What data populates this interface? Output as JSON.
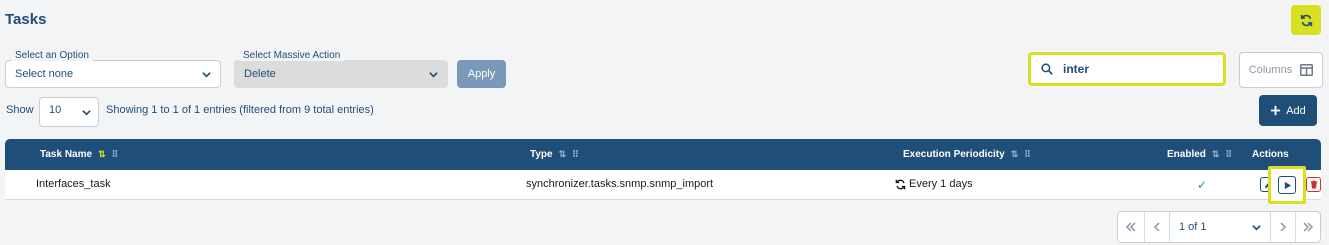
{
  "header": {
    "title": "Tasks",
    "refresh_icon": "refresh-icon"
  },
  "filters": {
    "option_label": "Select an Option",
    "option_value": "Select none",
    "massive_label": "Select Massive Action",
    "massive_value": "Delete",
    "apply_label": "Apply"
  },
  "search": {
    "value": "inter",
    "icon": "search-icon"
  },
  "columns_button": {
    "label": "Columns",
    "icon": "columns-icon"
  },
  "length": {
    "show_label": "Show",
    "value": "10"
  },
  "info": "Showing 1 to 1 of 1 entries (filtered from 9 total entries)",
  "add_button": {
    "label": "Add",
    "icon": "plus-icon"
  },
  "table": {
    "columns": [
      "Task Name",
      "Type",
      "Execution Periodicity",
      "Enabled",
      "Actions"
    ],
    "rows": [
      {
        "task_name": "Interfaces_task",
        "type": "synchronizer.tasks.snmp.snmp_import",
        "periodicity": "Every 1 days",
        "enabled": true,
        "actions": [
          "edit-icon",
          "run-icon",
          "delete-icon"
        ]
      }
    ]
  },
  "pagination": {
    "page_label": "1 of 1"
  },
  "colors": {
    "primary": "#1f4e79",
    "highlight": "#d9e021",
    "danger": "#d32f2f",
    "success": "#2e9e4e"
  }
}
